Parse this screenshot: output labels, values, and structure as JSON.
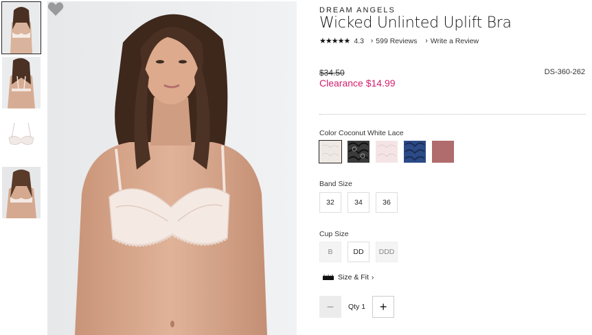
{
  "product": {
    "brand": "DREAM ANGELS",
    "title": "Wicked Unlinted Uplift Bra",
    "stars": "★★★★★",
    "rating": "4.3",
    "reviews_link": "599 Reviews",
    "write_review_link": "Write a Review",
    "original_price": "$34.50",
    "clearance_price": "Clearance $14.99",
    "sku": "DS-360-262"
  },
  "color": {
    "label": "Color",
    "selected_name": "Coconut White Lace",
    "swatches": [
      {
        "name": "Coconut White Lace",
        "hex": "#efe9e6"
      },
      {
        "name": "Black Lace",
        "hex": "#2a2a2a"
      },
      {
        "name": "Pink Lace",
        "hex": "#f2e2e4"
      },
      {
        "name": "Navy Lace",
        "hex": "#2b4a86"
      },
      {
        "name": "Mauve",
        "hex": "#b06b6c"
      }
    ]
  },
  "band": {
    "label": "Band Size",
    "options": [
      "32",
      "34",
      "36"
    ]
  },
  "cup": {
    "label": "Cup Size",
    "options": [
      "B",
      "DD",
      "DDD"
    ]
  },
  "size_fit_link": "Size & Fit",
  "quantity": {
    "label": "Qty",
    "value": "1",
    "minus": "−",
    "plus": "+"
  },
  "colors": {
    "accent": "#d11e6e",
    "favorite_heart": "#9a9a9a"
  },
  "icons": [
    "favorite-heart-icon",
    "ruler-icon",
    "chevron-right-icon"
  ]
}
